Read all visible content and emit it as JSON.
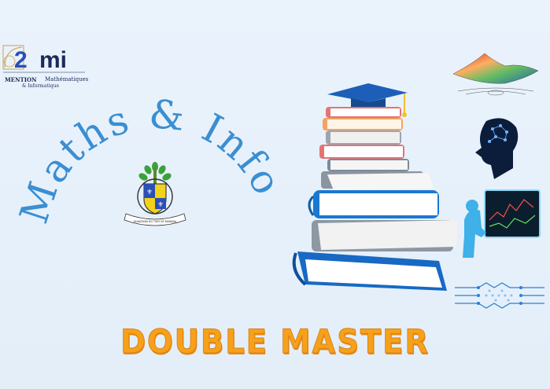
{
  "logo": {
    "number": "2",
    "letters": "mi",
    "line1_left": "MENTION",
    "line1_right": "Mathématiques",
    "line2": "& Informatique"
  },
  "title": "Maths & Info",
  "crest": {
    "motto": "FAHAIZANA NO TOKY NY MAMANA"
  },
  "banner": "DOUBLE MASTER",
  "icons": {
    "books": "stack-of-books-with-graduation-cap",
    "surface": "3d-surface-plot",
    "head": "ai-brain-head",
    "robot": "robot-with-monitor",
    "circuit": "circuit-board"
  },
  "colors": {
    "background": "#e6f0fa",
    "title": "#3b8ed1",
    "banner": "#f7a11a",
    "navy": "#1b2a5c"
  }
}
